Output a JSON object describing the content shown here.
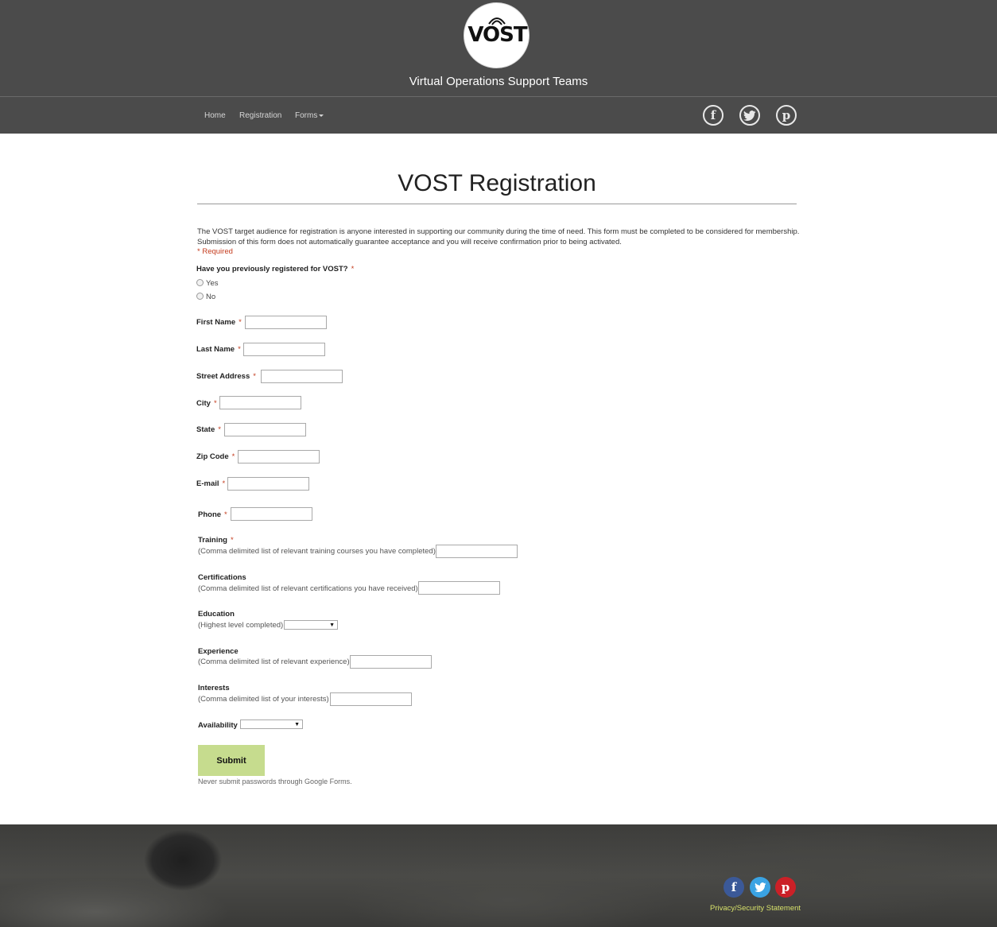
{
  "header": {
    "logo_text": "VOST",
    "site_title": "Virtual Operations Support Teams"
  },
  "nav": {
    "items": [
      {
        "label": "Home"
      },
      {
        "label": "Registration"
      },
      {
        "label": "Forms"
      }
    ],
    "social": [
      "facebook-icon",
      "twitter-icon",
      "pinterest-icon"
    ]
  },
  "form": {
    "title": "VOST Registration",
    "intro_line1": "The VOST target audience for registration is anyone interested in supporting our community during the time of need. This form must be completed to be considered for membership.",
    "intro_line2": "Submission of this form does not automatically guarantee acceptance and you will receive confirmation prior to being activated.",
    "required_note": "* Required",
    "asterisk": "*",
    "question": "Have you previously registered for VOST?",
    "options": [
      "Yes",
      "No"
    ],
    "fields": {
      "first_name": {
        "label": "First Name",
        "value": ""
      },
      "last_name": {
        "label": "Last Name",
        "value": ""
      },
      "street": {
        "label": "Street Address",
        "value": ""
      },
      "city": {
        "label": "City",
        "value": ""
      },
      "state": {
        "label": "State",
        "value": ""
      },
      "zip": {
        "label": "Zip Code",
        "value": ""
      },
      "email": {
        "label": "E-mail",
        "value": ""
      },
      "phone": {
        "label": "Phone",
        "value": ""
      },
      "training": {
        "label": "Training",
        "help": "(Comma delimited list of relevant training courses you have completed)",
        "value": ""
      },
      "certifications": {
        "label": "Certifications",
        "help": "(Comma delimited list of relevant certifications you have received)",
        "value": ""
      },
      "education": {
        "label": "Education",
        "help": "(Highest level completed)",
        "selected": ""
      },
      "experience": {
        "label": "Experience",
        "help": "(Comma delimited list of relevant experience)",
        "value": ""
      },
      "interests": {
        "label": "Interests",
        "help": "(Comma delimited list of your interests)",
        "value": ""
      },
      "availability": {
        "label": "Availability",
        "selected": ""
      }
    },
    "submit_label": "Submit",
    "password_note": "Never submit passwords through Google Forms."
  },
  "footer": {
    "social": [
      "facebook-icon",
      "twitter-icon",
      "pinterest-icon"
    ],
    "privacy_link": "Privacy/Security Statement"
  },
  "colors": {
    "header_bg": "#4b4b4b",
    "required": "#c43b1d",
    "submit_bg": "#c6dc8e",
    "facebook": "#3b5998",
    "twitter": "#3aa3e3",
    "pinterest": "#cb2027",
    "privacy_link": "#d6e06a"
  }
}
